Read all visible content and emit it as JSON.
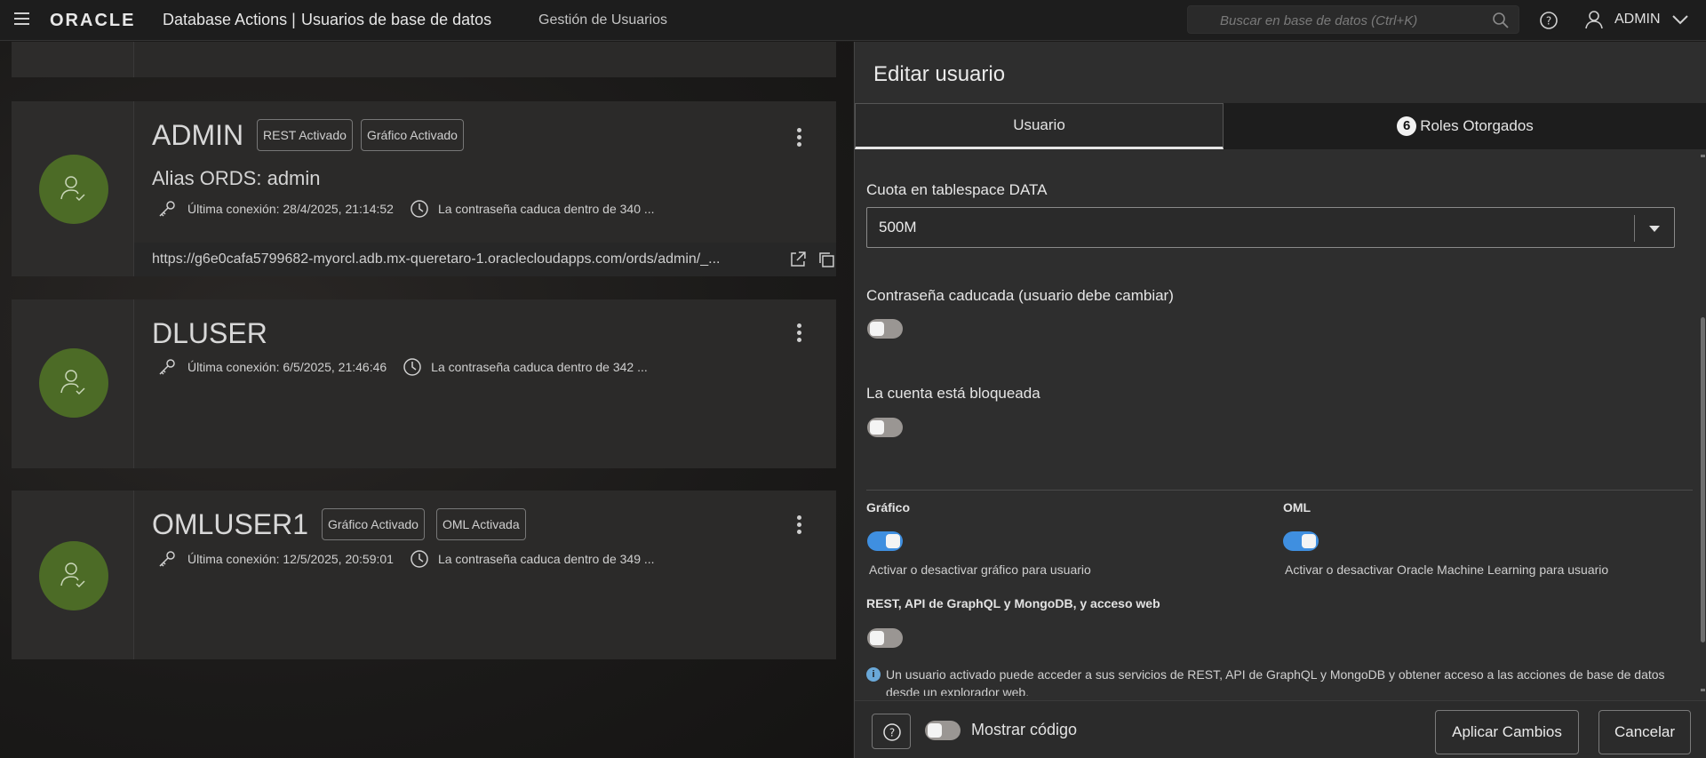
{
  "header": {
    "logo": "ORACLE",
    "app_name": "Database Actions |",
    "page_name": "Usuarios de base de datos",
    "subtitle": "Gestión de Usuarios",
    "search_placeholder": "Buscar en base de datos (Ctrl+K)",
    "user": "ADMIN"
  },
  "users": [
    {
      "name": "ADMIN",
      "badges": [
        "REST Activado",
        "Gráfico Activado"
      ],
      "alias": "Alias ORDS: admin",
      "last_login": "Última conexión: 28/4/2025, 21:14:52",
      "password": "La contraseña caduca dentro de 340 ...",
      "url": "https://g6e0cafa5799682-myorcl.adb.mx-queretaro-1.oraclecloudapps.com/ords/admin/_..."
    },
    {
      "name": "DLUSER",
      "badges": [],
      "last_login": "Última conexión: 6/5/2025, 21:46:46",
      "password": "La contraseña caduca dentro de 342 ..."
    },
    {
      "name": "OMLUSER1",
      "badges": [
        "Gráfico Activado",
        "OML Activada"
      ],
      "last_login": "Última conexión: 12/5/2025, 20:59:01",
      "password": "La contraseña caduca dentro de 349 ..."
    }
  ],
  "drawer": {
    "title": "Editar usuario",
    "tabs": {
      "user": "Usuario",
      "roles_count": "6",
      "roles": "Roles Otorgados"
    },
    "quota_label": "Cuota en tablespace DATA",
    "quota_value": "500M",
    "expired_label": "Contraseña caducada (usuario debe cambiar)",
    "expired_on": false,
    "locked_label": "La cuenta está bloqueada",
    "locked_on": false,
    "graph": {
      "title": "Gráfico",
      "desc": "Activar o desactivar gráfico para usuario",
      "on": true
    },
    "oml": {
      "title": "OML",
      "desc": "Activar o desactivar Oracle Machine Learning para usuario",
      "on": true
    },
    "rest": {
      "title": "REST, API de GraphQL y MongoDB, y acceso web",
      "on": false
    },
    "info": "Un usuario activado puede acceder a sus servicios de REST, API de GraphQL y MongoDB y obtener acceso a las acciones de base de datos desde un explorador web.",
    "show_code": "Mostrar código",
    "show_code_on": false,
    "apply": "Aplicar Cambios",
    "cancel": "Cancelar"
  }
}
